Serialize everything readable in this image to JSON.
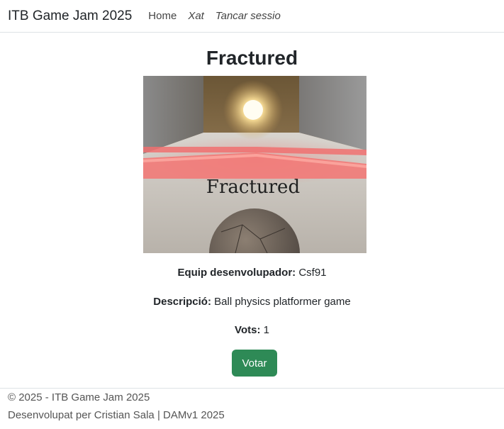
{
  "navbar": {
    "brand": "ITB Game Jam 2025",
    "links": [
      {
        "label": "Home"
      },
      {
        "label": "Xat"
      },
      {
        "label": "Tancar sessio"
      }
    ]
  },
  "game": {
    "title": "Fractured",
    "cover_text": "Fractured",
    "team_label": "Equip desenvolupador:",
    "team_value": "Csf91",
    "description_label": "Descripció:",
    "description_value": "Ball physics platformer game",
    "votes_label": "Vots:",
    "votes_value": "1",
    "vote_button": "Votar"
  },
  "footer": {
    "copyright": "© 2025 - ITB Game Jam 2025",
    "credits": "Desenvolupat per Cristian Sala | DAMv1 2025"
  },
  "colors": {
    "vote_button": "#2e8a56",
    "accent_stripe": "#f07070"
  }
}
